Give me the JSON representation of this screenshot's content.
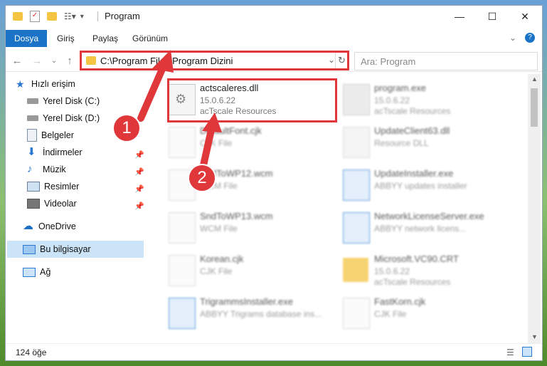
{
  "window": {
    "title": "Program"
  },
  "ribbon": {
    "tabs": [
      "Dosya",
      "Giriş",
      "Paylaş",
      "Görünüm"
    ]
  },
  "address": {
    "path": "C:\\Program Files\\Program Dizini"
  },
  "search": {
    "placeholder": "Ara: Program"
  },
  "sidebar": {
    "quick_access": "Hızlı erişim",
    "items": [
      {
        "label": "Yerel Disk (C:)"
      },
      {
        "label": "Yerel Disk (D:)"
      },
      {
        "label": "Belgeler"
      },
      {
        "label": "İndirmeler"
      },
      {
        "label": "Müzik"
      },
      {
        "label": "Resimler"
      },
      {
        "label": "Videolar"
      }
    ],
    "onedrive": "OneDrive",
    "this_pc": "Bu bilgisayar",
    "network": "Ağ"
  },
  "files": {
    "highlighted": {
      "name": "actscaleres.dll",
      "version": "15.0.6.22",
      "company": "acTscale Resources"
    },
    "f1": {
      "name": "program.exe",
      "sub1": "15.0.6.22",
      "sub2": "acTscale Resources"
    },
    "f2": {
      "name": "DefaultFont.cjk",
      "sub1": "CJK File"
    },
    "f3": {
      "name": "UpdateClient63.dll",
      "sub1": "Resource DLL"
    },
    "f4": {
      "name": "SndToWP12.wcm",
      "sub1": "WCM File"
    },
    "f5": {
      "name": "UpdateInstaller.exe",
      "sub1": "ABBYY updates installer"
    },
    "f6": {
      "name": "SndToWP13.wcm",
      "sub1": "WCM File"
    },
    "f7": {
      "name": "NetworkLicenseServer.exe",
      "sub1": "ABBYY network licens..."
    },
    "f8": {
      "name": "Korean.cjk",
      "sub1": "CJK File"
    },
    "f9": {
      "name": "Microsoft.VC90.CRT",
      "sub1": "15.0.6.22",
      "sub2": "acTscale Resources"
    },
    "f10": {
      "name": "TrigrammsInstaller.exe",
      "sub1": "ABBYY Trigrams database ins..."
    },
    "f11": {
      "name": "FastKorn.cjk",
      "sub1": "CJK File"
    }
  },
  "status": {
    "count": "124 öğe"
  },
  "callouts": {
    "one": "1",
    "two": "2"
  },
  "colors": {
    "accent": "#1a73c6",
    "highlight": "#e0373b"
  }
}
